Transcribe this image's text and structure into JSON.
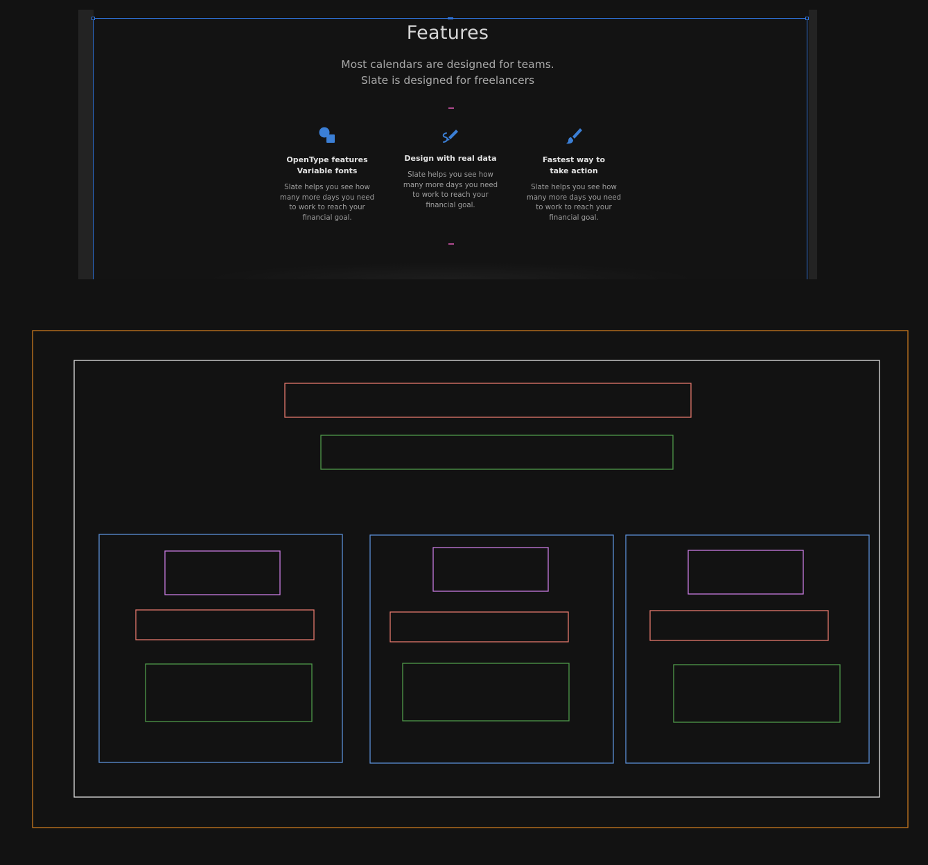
{
  "preview": {
    "title": "Features",
    "subtitle_line1": "Most calendars are designed for teams.",
    "subtitle_line2": "Slate is designed for freelancers",
    "features": [
      {
        "icon": "shapes-icon",
        "title": "OpenType features\nVariable fonts",
        "description": "Slate helps you see how many more days you need to work to reach your financial goal."
      },
      {
        "icon": "pen-icon",
        "title": "Design with real data",
        "description": "Slate helps you see how many more days you need to work to reach your financial goal."
      },
      {
        "icon": "brush-icon",
        "title": "Fastest way to\ntake action",
        "description": "Slate helps you see how many more days you need to work to reach your financial goal."
      }
    ]
  },
  "colors": {
    "background": "#121212",
    "accent": "#2f73d9",
    "icon": "#3b7fd6",
    "dash": "#b04a8f",
    "sketch_outer": "#c8781e",
    "sketch_frame": "#e0e0e0",
    "sketch_title": "#e5786d",
    "sketch_subtitle": "#4f9a4a",
    "sketch_card": "#5b8fd6",
    "sketch_icon": "#c87be0"
  }
}
